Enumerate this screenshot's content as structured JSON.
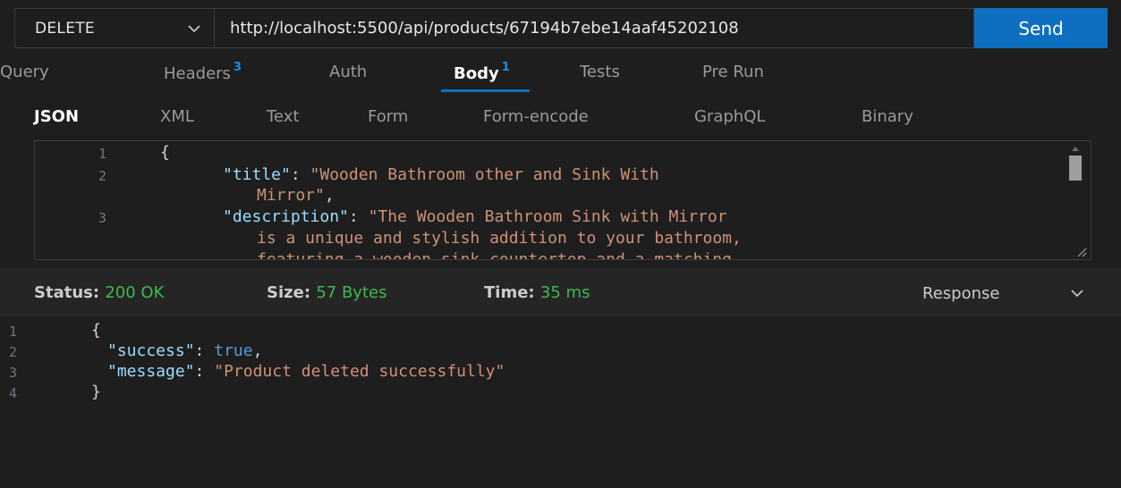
{
  "request": {
    "method": "DELETE",
    "url": "http://localhost:5500/api/products/67194b7ebe14aaf45202108",
    "send_label": "Send"
  },
  "tabs": [
    {
      "label": "Query",
      "badge": ""
    },
    {
      "label": "Headers",
      "badge": "3"
    },
    {
      "label": "Auth",
      "badge": ""
    },
    {
      "label": "Body",
      "badge": "1"
    },
    {
      "label": "Tests",
      "badge": ""
    },
    {
      "label": "Pre Run",
      "badge": ""
    }
  ],
  "active_tab": "Body",
  "body_tabs": [
    "JSON",
    "XML",
    "Text",
    "Form",
    "Form-encode",
    "GraphQL",
    "Binary"
  ],
  "active_body_tab": "JSON",
  "editor": {
    "line_numbers": [
      "1",
      "2",
      "3"
    ],
    "open_brace": "{",
    "title_key": "\"title\"",
    "title_value_1": "\"Wooden Bathroom other and Sink With",
    "title_value_2": "Mirror\"",
    "desc_key": "\"description\"",
    "desc_value_1": "\"The Wooden Bathroom Sink with Mirror",
    "desc_value_2": "is a unique and stylish addition to your bathroom,",
    "desc_value_3": "featuring a wooden sink countertop and a matching"
  },
  "status": {
    "status_label": "Status:",
    "status_value": "200 OK",
    "size_label": "Size:",
    "size_value": "57 Bytes",
    "time_label": "Time:",
    "time_value": "35 ms",
    "response_label": "Response"
  },
  "response": {
    "line_numbers": [
      "1",
      "2",
      "3",
      "4"
    ],
    "open_brace": "{",
    "success_key": "\"success\"",
    "success_value": "true",
    "message_key": "\"message\"",
    "message_value": "\"Product deleted successfully\"",
    "close_brace": "}"
  },
  "colors": {
    "accent": "#0e6fc0",
    "status_ok": "#3fb950",
    "json_key": "#9cdcfe",
    "json_string": "#ce9178",
    "json_bool": "#569cd6"
  }
}
